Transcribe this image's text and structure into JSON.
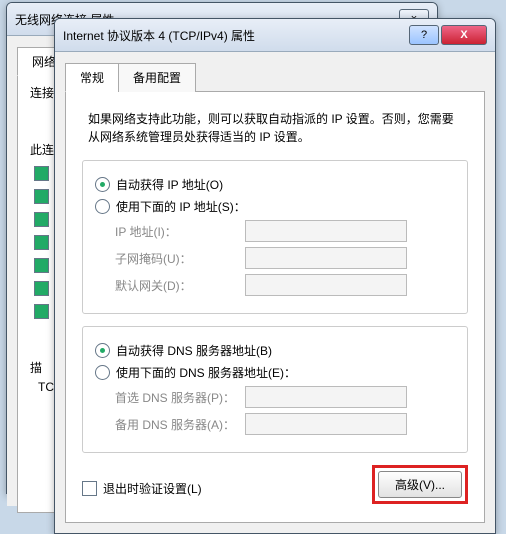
{
  "backWindow": {
    "title": "无线网络连接 属性",
    "tabLabel": "网络",
    "connectLabel": "连接",
    "thisConnLabel": "此连",
    "descLabel": "描",
    "tcpLabel": "TC"
  },
  "frontWindow": {
    "title": "Internet 协议版本 4 (TCP/IPv4) 属性",
    "tabs": {
      "general": "常规",
      "alt": "备用配置"
    },
    "info": "如果网络支持此功能，则可以获取自动指派的 IP 设置。否则，您需要从网络系统管理员处获得适当的 IP 设置。",
    "ip": {
      "auto": "自动获得 IP 地址(O)",
      "manual": "使用下面的 IP 地址(S)：",
      "addr": "IP 地址(I)：",
      "mask": "子网掩码(U)：",
      "gateway": "默认网关(D)："
    },
    "dns": {
      "auto": "自动获得 DNS 服务器地址(B)",
      "manual": "使用下面的 DNS 服务器地址(E)：",
      "pref": "首选 DNS 服务器(P)：",
      "alt": "备用 DNS 服务器(A)："
    },
    "validate": "退出时验证设置(L)",
    "advanced": "高级(V)..."
  }
}
